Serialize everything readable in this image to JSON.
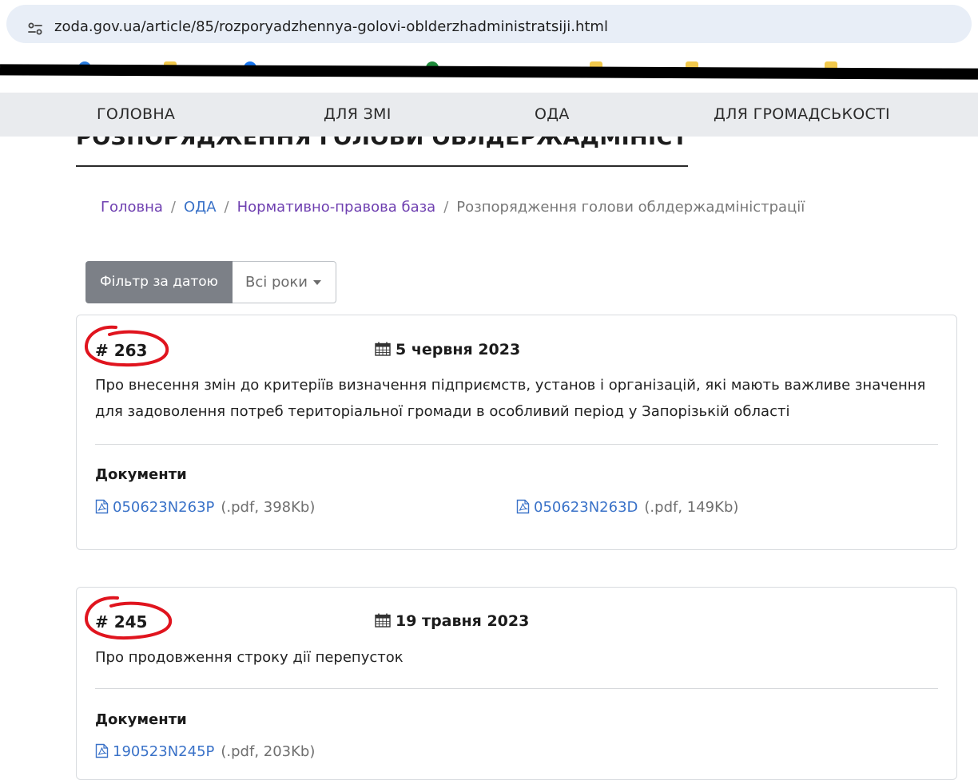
{
  "browser": {
    "url": "zoda.gov.ua/article/85/rozporyadzhennya-golovi-oblderzhadministratsiji.html"
  },
  "site_nav": {
    "items": [
      "ГОЛОВНА",
      "ДЛЯ ЗМІ",
      "ОДА",
      "ДЛЯ ГРОМАДСЬКОСТІ"
    ]
  },
  "page": {
    "title": "РОЗПОРЯДЖЕННЯ ГОЛОВИ ОБЛДЕРЖАДМІНІСТРАЦІЇ"
  },
  "breadcrumb": {
    "items": [
      "Головна",
      "ОДА",
      "Нормативно-правова база",
      "Розпорядження голови облдержадміністрації"
    ],
    "separator": "/"
  },
  "filter": {
    "label": "Фільтр за датою",
    "selected": "Всі роки"
  },
  "documents": [
    {
      "number": "# 263",
      "date": "5 червня 2023",
      "title": "Про внесення змін до критеріїв визначення підприємств, установ і організацій, які мають важливе значення для задоволення потреб територіальної громади в особливий період у Запорізькій області",
      "docs_label": "Документи",
      "files": [
        {
          "name": "050623N263P",
          "meta": "(.pdf, 398Kb)"
        },
        {
          "name": "050623N263D",
          "meta": "(.pdf, 149Kb)"
        }
      ]
    },
    {
      "number": "# 245",
      "date": "19 травня 2023",
      "title": "Про продовження строку дії перепусток",
      "docs_label": "Документи",
      "files": [
        {
          "name": "190523N245P",
          "meta": "(.pdf, 203Kb)"
        }
      ]
    }
  ],
  "colors": {
    "link": "#3a72c8",
    "breadcrumb_link": "#6e3fb0",
    "annotation": "#e0141e",
    "nav_bg": "#e9ebee"
  }
}
